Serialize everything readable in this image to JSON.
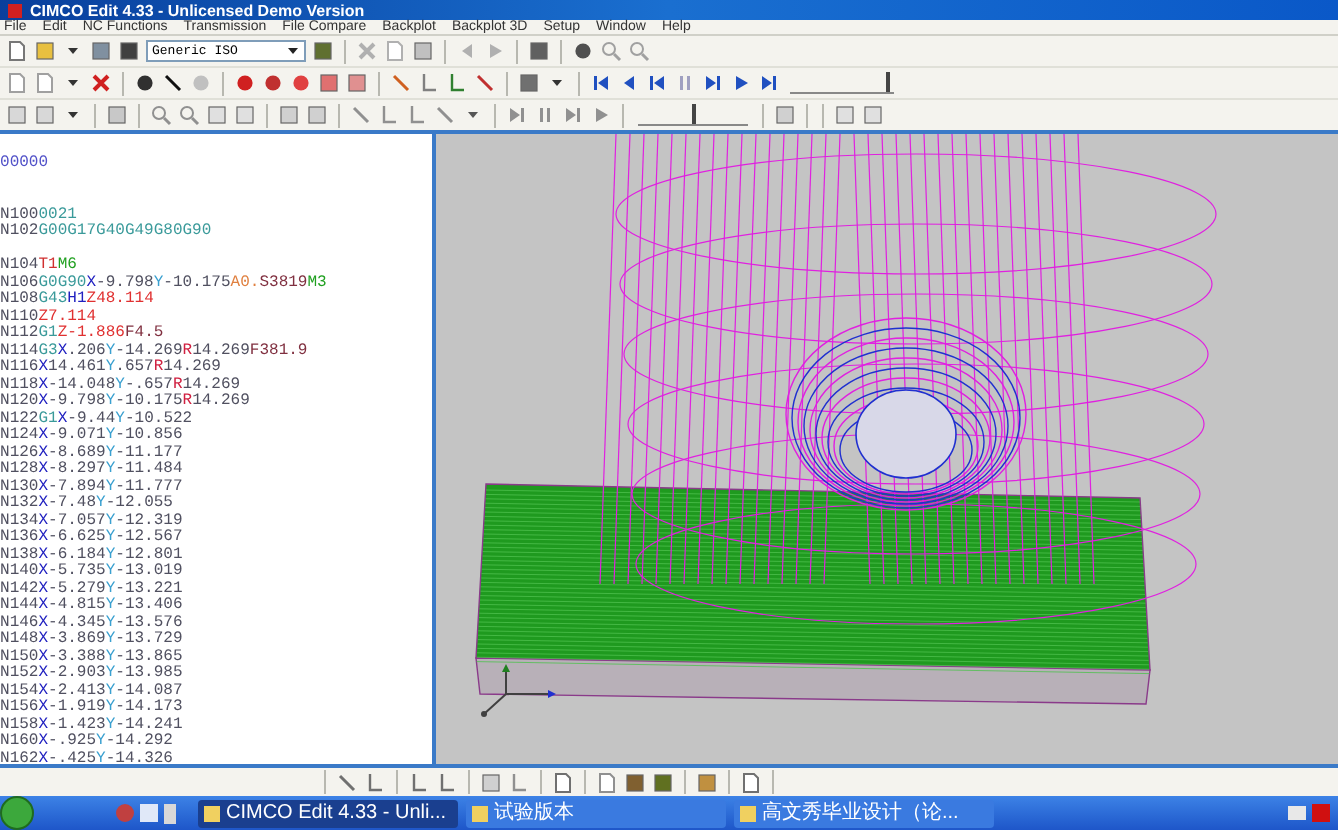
{
  "window": {
    "title": "CIMCO Edit 4.33 - Unlicensed Demo Version"
  },
  "menu": [
    "File",
    "Edit",
    "NC Functions",
    "Transmission",
    "File Compare",
    "Backplot",
    "Backplot 3D",
    "Setup",
    "Window",
    "Help"
  ],
  "toolbar": {
    "machine_combo": {
      "value": "Generic ISO"
    }
  },
  "sliders": [
    {
      "level": 0.95
    },
    {
      "level": 0.5
    }
  ],
  "editor": {
    "lines": [
      {
        "tokens": [
          {
            "text": "00000",
            "kind": "o"
          }
        ]
      },
      {
        "blank": true
      },
      {
        "blank": true
      },
      {
        "tokens": [
          {
            "text": "N100",
            "kind": "n"
          },
          {
            "text": "0021",
            "kind": "g"
          }
        ]
      },
      {
        "tokens": [
          {
            "text": "N102",
            "kind": "n"
          },
          {
            "text": "G00G17G40G49G80G90",
            "kind": "g"
          }
        ]
      },
      {
        "blank": true
      },
      {
        "tokens": [
          {
            "text": "N104",
            "kind": "n"
          },
          {
            "text": "T1",
            "kind": "t"
          },
          {
            "text": "M6",
            "kind": "m"
          }
        ]
      },
      {
        "tokens": [
          {
            "text": "N106",
            "kind": "n"
          },
          {
            "text": "G0G90",
            "kind": "g"
          },
          {
            "text": "X-9.798",
            "kind": "x"
          },
          {
            "text": "Y-10.175",
            "kind": "y"
          },
          {
            "text": "A0.",
            "kind": "a"
          },
          {
            "text": "S3819",
            "kind": "s"
          },
          {
            "text": "M3",
            "kind": "m"
          }
        ]
      },
      {
        "tokens": [
          {
            "text": "N108",
            "kind": "n"
          },
          {
            "text": "G43",
            "kind": "g"
          },
          {
            "text": "H1",
            "kind": "h"
          },
          {
            "text": "Z48.114",
            "kind": "z"
          }
        ]
      },
      {
        "tokens": [
          {
            "text": "N110",
            "kind": "n"
          },
          {
            "text": "Z7.114",
            "kind": "z"
          }
        ]
      },
      {
        "tokens": [
          {
            "text": "N112",
            "kind": "n"
          },
          {
            "text": "G1",
            "kind": "g"
          },
          {
            "text": "Z-1.886",
            "kind": "z"
          },
          {
            "text": "F4.5",
            "kind": "s"
          }
        ]
      },
      {
        "tokens": [
          {
            "text": "N114",
            "kind": "n"
          },
          {
            "text": "G3",
            "kind": "g"
          },
          {
            "text": "X.206",
            "kind": "x"
          },
          {
            "text": "Y-14.269",
            "kind": "y"
          },
          {
            "text": "R14.269",
            "kind": "r"
          },
          {
            "text": "F381.9",
            "kind": "s"
          }
        ]
      },
      {
        "tokens": [
          {
            "text": "N116",
            "kind": "n"
          },
          {
            "text": "X14.461",
            "kind": "x"
          },
          {
            "text": "Y.657",
            "kind": "y"
          },
          {
            "text": "R14.269",
            "kind": "r"
          }
        ]
      },
      {
        "tokens": [
          {
            "text": "N118",
            "kind": "n"
          },
          {
            "text": "X-14.048",
            "kind": "x"
          },
          {
            "text": "Y-.657",
            "kind": "y"
          },
          {
            "text": "R14.269",
            "kind": "r"
          }
        ]
      },
      {
        "tokens": [
          {
            "text": "N120",
            "kind": "n"
          },
          {
            "text": "X-9.798",
            "kind": "x"
          },
          {
            "text": "Y-10.175",
            "kind": "y"
          },
          {
            "text": "R14.269",
            "kind": "r"
          }
        ]
      },
      {
        "tokens": [
          {
            "text": "N122",
            "kind": "n"
          },
          {
            "text": "G1",
            "kind": "g"
          },
          {
            "text": "X-9.44",
            "kind": "x"
          },
          {
            "text": "Y-10.522",
            "kind": "y"
          }
        ]
      },
      {
        "tokens": [
          {
            "text": "N124",
            "kind": "n"
          },
          {
            "text": "X-9.071",
            "kind": "x"
          },
          {
            "text": "Y-10.856",
            "kind": "y"
          }
        ]
      },
      {
        "tokens": [
          {
            "text": "N126",
            "kind": "n"
          },
          {
            "text": "X-8.689",
            "kind": "x"
          },
          {
            "text": "Y-11.177",
            "kind": "y"
          }
        ]
      },
      {
        "tokens": [
          {
            "text": "N128",
            "kind": "n"
          },
          {
            "text": "X-8.297",
            "kind": "x"
          },
          {
            "text": "Y-11.484",
            "kind": "y"
          }
        ]
      },
      {
        "tokens": [
          {
            "text": "N130",
            "kind": "n"
          },
          {
            "text": "X-7.894",
            "kind": "x"
          },
          {
            "text": "Y-11.777",
            "kind": "y"
          }
        ]
      },
      {
        "tokens": [
          {
            "text": "N132",
            "kind": "n"
          },
          {
            "text": "X-7.48",
            "kind": "x"
          },
          {
            "text": "Y-12.055",
            "kind": "y"
          }
        ]
      },
      {
        "tokens": [
          {
            "text": "N134",
            "kind": "n"
          },
          {
            "text": "X-7.057",
            "kind": "x"
          },
          {
            "text": "Y-12.319",
            "kind": "y"
          }
        ]
      },
      {
        "tokens": [
          {
            "text": "N136",
            "kind": "n"
          },
          {
            "text": "X-6.625",
            "kind": "x"
          },
          {
            "text": "Y-12.567",
            "kind": "y"
          }
        ]
      },
      {
        "tokens": [
          {
            "text": "N138",
            "kind": "n"
          },
          {
            "text": "X-6.184",
            "kind": "x"
          },
          {
            "text": "Y-12.801",
            "kind": "y"
          }
        ]
      },
      {
        "tokens": [
          {
            "text": "N140",
            "kind": "n"
          },
          {
            "text": "X-5.735",
            "kind": "x"
          },
          {
            "text": "Y-13.019",
            "kind": "y"
          }
        ]
      },
      {
        "tokens": [
          {
            "text": "N142",
            "kind": "n"
          },
          {
            "text": "X-5.279",
            "kind": "x"
          },
          {
            "text": "Y-13.221",
            "kind": "y"
          }
        ]
      },
      {
        "tokens": [
          {
            "text": "N144",
            "kind": "n"
          },
          {
            "text": "X-4.815",
            "kind": "x"
          },
          {
            "text": "Y-13.406",
            "kind": "y"
          }
        ]
      },
      {
        "tokens": [
          {
            "text": "N146",
            "kind": "n"
          },
          {
            "text": "X-4.345",
            "kind": "x"
          },
          {
            "text": "Y-13.576",
            "kind": "y"
          }
        ]
      },
      {
        "tokens": [
          {
            "text": "N148",
            "kind": "n"
          },
          {
            "text": "X-3.869",
            "kind": "x"
          },
          {
            "text": "Y-13.729",
            "kind": "y"
          }
        ]
      },
      {
        "tokens": [
          {
            "text": "N150",
            "kind": "n"
          },
          {
            "text": "X-3.388",
            "kind": "x"
          },
          {
            "text": "Y-13.865",
            "kind": "y"
          }
        ]
      },
      {
        "tokens": [
          {
            "text": "N152",
            "kind": "n"
          },
          {
            "text": "X-2.903",
            "kind": "x"
          },
          {
            "text": "Y-13.985",
            "kind": "y"
          }
        ]
      },
      {
        "tokens": [
          {
            "text": "N154",
            "kind": "n"
          },
          {
            "text": "X-2.413",
            "kind": "x"
          },
          {
            "text": "Y-14.087",
            "kind": "y"
          }
        ]
      },
      {
        "tokens": [
          {
            "text": "N156",
            "kind": "n"
          },
          {
            "text": "X-1.919",
            "kind": "x"
          },
          {
            "text": "Y-14.173",
            "kind": "y"
          }
        ]
      },
      {
        "tokens": [
          {
            "text": "N158",
            "kind": "n"
          },
          {
            "text": "X-1.423",
            "kind": "x"
          },
          {
            "text": "Y-14.241",
            "kind": "y"
          }
        ]
      },
      {
        "tokens": [
          {
            "text": "N160",
            "kind": "n"
          },
          {
            "text": "X-.925",
            "kind": "x"
          },
          {
            "text": "Y-14.292",
            "kind": "y"
          }
        ]
      },
      {
        "tokens": [
          {
            "text": "N162",
            "kind": "n"
          },
          {
            "text": "X-.425",
            "kind": "x"
          },
          {
            "text": "Y-14.326",
            "kind": "y"
          }
        ]
      }
    ]
  },
  "taskbar": {
    "tasks": [
      {
        "label": "CIMCO Edit 4.33 - Unli...",
        "selected": true
      },
      {
        "label": "试验版本",
        "selected": false
      },
      {
        "label": "高文秀毕业设计（论...",
        "selected": false
      }
    ]
  }
}
